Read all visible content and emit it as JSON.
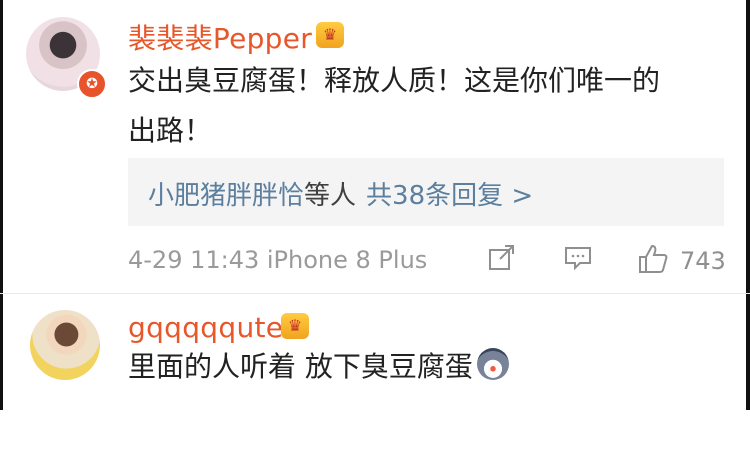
{
  "comments": [
    {
      "username": "裴裴裴Pepper",
      "text_line1": "交出臭豆腐蛋！释放人质！这是你们唯一的",
      "text_line2": "出路！",
      "reply_summary": {
        "names": "小肥猪胖胖恰",
        "suffix": "等人",
        "count_text": "共38条回复 >"
      },
      "meta": "4-29 11:43 iPhone 8 Plus",
      "like_count": "743",
      "icons": [
        "avatar",
        "verified-badge-icon",
        "crown-vip-icon",
        "share-icon",
        "comment-icon",
        "like-icon"
      ]
    },
    {
      "username": "gqqqqqute",
      "text": "里面的人听着 放下臭豆腐蛋",
      "icons": [
        "avatar",
        "crown-vip-icon",
        "husky-emoji-icon"
      ]
    }
  ],
  "colors": {
    "username": "#e8572a",
    "reply_link": "#5c7f9e",
    "meta_text": "#9a9a9a",
    "reply_bg": "#f4f4f4"
  }
}
